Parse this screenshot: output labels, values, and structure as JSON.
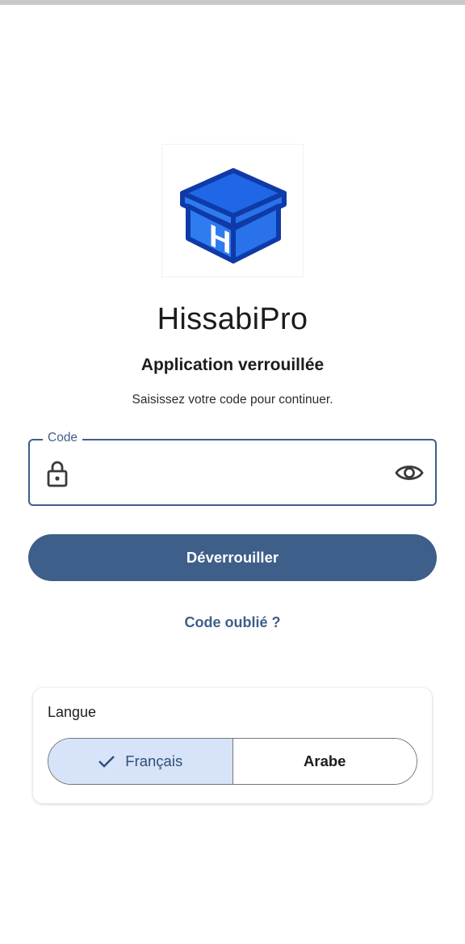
{
  "app": {
    "name": "HissabiPro",
    "logo_letter": "H"
  },
  "lock": {
    "title": "Application verrouillée",
    "subtitle": "Saisissez votre code pour continuer."
  },
  "code_field": {
    "label": "Code",
    "value": "",
    "leading_icon": "lock-icon",
    "trailing_icon": "eye-icon"
  },
  "actions": {
    "unlock_label": "Déverrouiller",
    "forgot_label": "Code oublié ?"
  },
  "language": {
    "label": "Langue",
    "options": [
      {
        "label": "Français",
        "selected": true
      },
      {
        "label": "Arabe",
        "selected": false
      }
    ]
  },
  "colors": {
    "primary": "#3e5f8a",
    "selected_segment": "#d7e3f8",
    "logo_blue": "#1f67e6",
    "logo_dark": "#0f3aa8"
  }
}
